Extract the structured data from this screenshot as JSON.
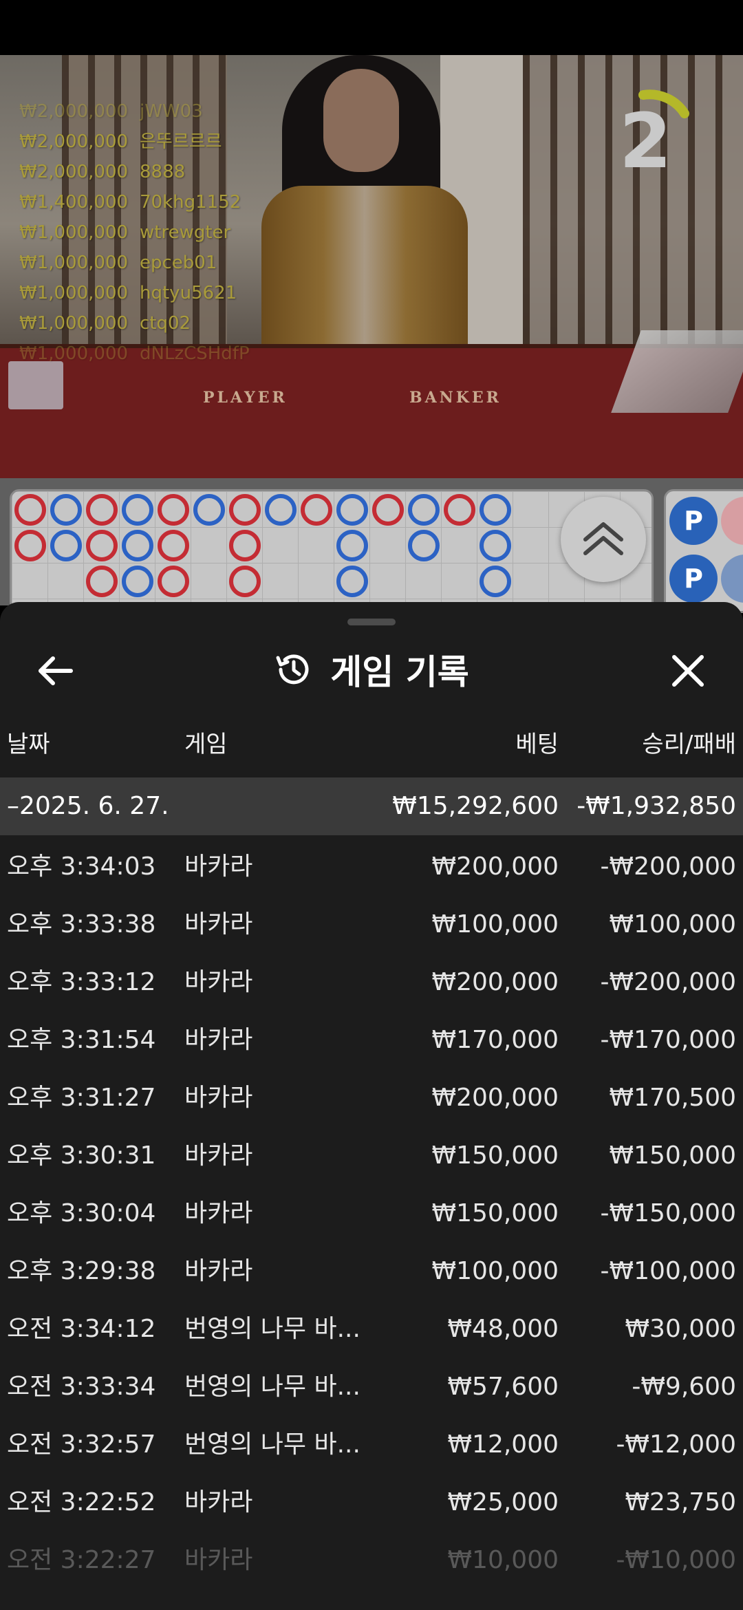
{
  "live_video": {
    "top_bets": [
      {
        "amount": "₩2,000,000",
        "user": "jWW03"
      },
      {
        "amount": "₩2,000,000",
        "user": "은뚜르르르"
      },
      {
        "amount": "₩2,000,000",
        "user": "8888"
      },
      {
        "amount": "₩1,400,000",
        "user": "70khg1152"
      },
      {
        "amount": "₩1,000,000",
        "user": "wtrewgter"
      },
      {
        "amount": "₩1,000,000",
        "user": "epceb01"
      },
      {
        "amount": "₩1,000,000",
        "user": "hqtyu5621"
      },
      {
        "amount": "₩1,000,000",
        "user": "ctq02"
      },
      {
        "amount": "₩1,000,000",
        "user": "dNLzCSHdfP"
      }
    ],
    "round_number": "2",
    "table_labels": {
      "player": "PLAYER",
      "banker": "BANKER"
    }
  },
  "roadmap": {
    "side_chip_label": "P"
  },
  "history_sheet": {
    "title": "게임 기록",
    "icons": {
      "back": "arrow-left-icon",
      "history": "history-icon",
      "close": "close-icon"
    },
    "columns": {
      "date": "날짜",
      "game": "게임",
      "bet": "베팅",
      "result": "승리/패배"
    },
    "day_summary": {
      "date": "2025. 6. 27.",
      "bet": "₩15,292,600",
      "result": "-₩1,932,850"
    },
    "rows": [
      {
        "time": "오후 3:34:03",
        "game": "바카라",
        "bet": "₩200,000",
        "result": "-₩200,000"
      },
      {
        "time": "오후 3:33:38",
        "game": "바카라",
        "bet": "₩100,000",
        "result": "₩100,000"
      },
      {
        "time": "오후 3:33:12",
        "game": "바카라",
        "bet": "₩200,000",
        "result": "-₩200,000"
      },
      {
        "time": "오후 3:31:54",
        "game": "바카라",
        "bet": "₩170,000",
        "result": "-₩170,000"
      },
      {
        "time": "오후 3:31:27",
        "game": "바카라",
        "bet": "₩200,000",
        "result": "₩170,500"
      },
      {
        "time": "오후 3:30:31",
        "game": "바카라",
        "bet": "₩150,000",
        "result": "₩150,000"
      },
      {
        "time": "오후 3:30:04",
        "game": "바카라",
        "bet": "₩150,000",
        "result": "-₩150,000"
      },
      {
        "time": "오후 3:29:38",
        "game": "바카라",
        "bet": "₩100,000",
        "result": "-₩100,000"
      },
      {
        "time": "오전 3:34:12",
        "game": "번영의 나무 바...",
        "bet": "₩48,000",
        "result": "₩30,000"
      },
      {
        "time": "오전 3:33:34",
        "game": "번영의 나무 바...",
        "bet": "₩57,600",
        "result": "-₩9,600"
      },
      {
        "time": "오전 3:32:57",
        "game": "번영의 나무 바...",
        "bet": "₩12,000",
        "result": "-₩12,000"
      },
      {
        "time": "오전 3:22:52",
        "game": "바카라",
        "bet": "₩25,000",
        "result": "₩23,750"
      },
      {
        "time": "오전 3:22:27",
        "game": "바카라",
        "bet": "₩10,000",
        "result": "-₩10,000"
      }
    ]
  }
}
